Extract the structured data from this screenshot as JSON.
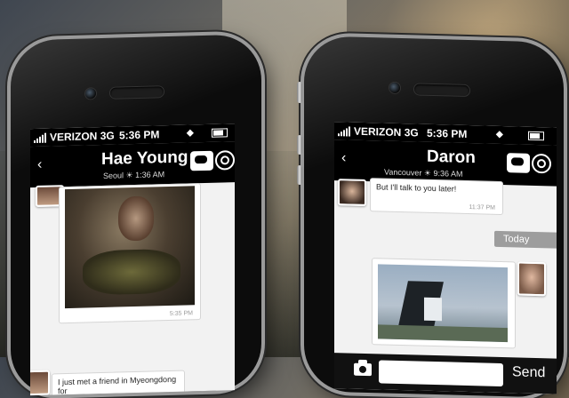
{
  "left_phone": {
    "status": {
      "carrier": "VERIZON",
      "network": "3G",
      "time": "5:36 PM"
    },
    "header": {
      "back_glyph": "‹",
      "contact_name": "Hae Young",
      "location": "Seoul",
      "weather_glyph": "☀",
      "local_time": "1:36 AM"
    },
    "messages": [
      {
        "type": "photo",
        "timestamp": "5:35 PM"
      },
      {
        "type": "text",
        "text": "I just met a friend in Myeongdong for"
      }
    ]
  },
  "right_phone": {
    "status": {
      "carrier": "VERIZON",
      "network": "3G",
      "time": "5:36 PM"
    },
    "header": {
      "back_glyph": "‹",
      "contact_name": "Daron",
      "location": "Vancouver",
      "weather_glyph": "☀",
      "local_time": "9:36 AM"
    },
    "messages": [
      {
        "type": "text",
        "text": "But I'll talk to you later!",
        "timestamp": "11:37 PM"
      },
      {
        "type": "divider",
        "label": "Today"
      },
      {
        "type": "photo"
      }
    ],
    "composer": {
      "input_value": "",
      "send_label": "Send"
    }
  },
  "icons": [
    "chat-icon",
    "target-icon",
    "camera-icon",
    "back-icon",
    "signal-icon",
    "battery-icon",
    "location-icon"
  ],
  "colors": {
    "bar": "#000000",
    "chat_bg": "#f2f2f2",
    "divider": "#9d9d9d"
  }
}
